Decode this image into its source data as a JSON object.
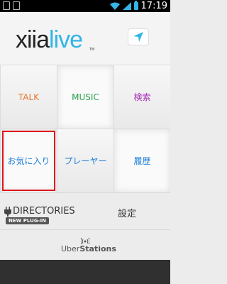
{
  "status_bar": {
    "time": "17:19"
  },
  "header": {
    "logo_part1": "xiia",
    "logo_part2": "live",
    "logo_tm": "TM"
  },
  "grid": [
    {
      "label": "TALK",
      "color": "#e8772e"
    },
    {
      "label": "MUSIC",
      "color": "#2aa04a"
    },
    {
      "label": "検索",
      "color": "#a532b5"
    },
    {
      "label": "お気に入り",
      "color": "#1f7fd6"
    },
    {
      "label": "プレーヤー",
      "color": "#1f7fd6"
    },
    {
      "label": "履歴",
      "color": "#1f7fd6"
    }
  ],
  "directories": {
    "label": "DIRECTORIES",
    "badge": "NEW PLUG-IN",
    "settings": "設定"
  },
  "footer": {
    "brand_light": "Uber",
    "brand_bold": "Stations"
  },
  "colors": {
    "accent": "#33b5e5",
    "highlight": "#e0161c"
  }
}
